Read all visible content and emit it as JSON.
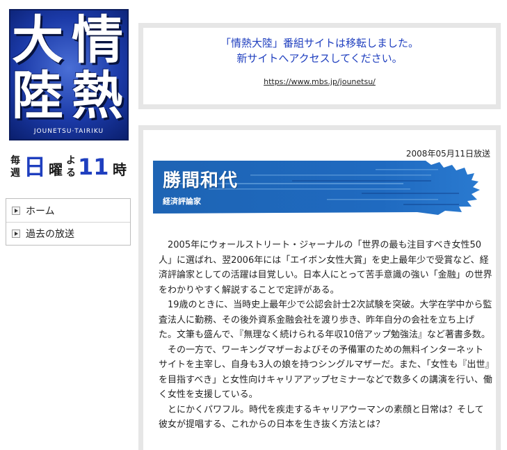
{
  "logo": {
    "kanji": [
      "大",
      "情",
      "陸",
      "熱"
    ],
    "subtitle": "JOUNETSU·TAIRIKU"
  },
  "schedule": {
    "mai": "毎",
    "shu": "週",
    "day": "日",
    "yobi": "曜",
    "yo": "よ",
    "ru": "る",
    "hour": "11",
    "ji": "時"
  },
  "nav": {
    "items": [
      {
        "label": "ホーム"
      },
      {
        "label": "過去の放送"
      }
    ]
  },
  "notice": {
    "line1": "「情熱大陸」番組サイトは移転しました。",
    "line2": "新サイトへアクセスしてください。",
    "url": "https://www.mbs.jp/jounetsu/"
  },
  "episode": {
    "air_date": "2008年05月11日放送",
    "guest_name": "勝間和代",
    "guest_title": "経済評論家",
    "bio": [
      "2005年にウォールストリート・ジャーナルの「世界の最も注目すべき女性50人」に選ばれ、翌2006年には「エイボン女性大賞」を史上最年少で受賞など、経済評論家としての活躍は目覚しい。日本人にとって苦手意識の強い「金融」の世界をわかりやすく解説することで定評がある。",
      "19歳のときに、当時史上最年少で公認会計士2次試験を突破。大学在学中から監査法人に勤務、その後外資系金融会社を渡り歩き、昨年自分の会社を立ち上げた。文筆も盛んで、『無理なく続けられる年収10倍アップ勉強法』など著書多数。",
      "その一方で、ワーキングマザーおよびその予備軍のための無料インターネットサイトを主宰し、自身も3人の娘を持つシングルマザーだ。また、「女性も『出世』を目指すべき」と女性向けキャリアアップセミナーなどで数多くの講演を行い、働く女性を支援している。",
      "とにかくパワフル。時代を疾走するキャリアウーマンの素顔と日常は？そして彼女が提唱する、これからの日本を生き抜く方法とは？"
    ]
  },
  "colors": {
    "accent_blue": "#1f3fbf",
    "banner_blue": "#1e64b4",
    "frame_gray": "#e6e6e6"
  }
}
